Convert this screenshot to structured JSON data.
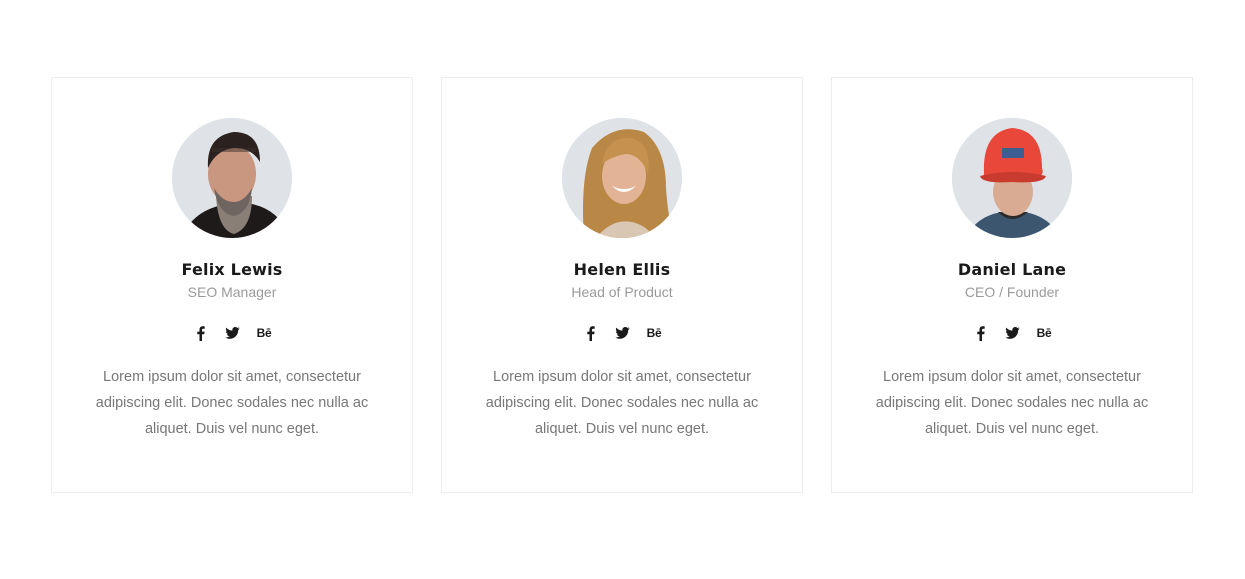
{
  "team": {
    "members": [
      {
        "name": "Felix Lewis",
        "role": "SEO Manager",
        "bio": "Lorem ipsum dolor sit amet, consectetur adipiscing elit. Donec sodales nec nulla ac aliquet. Duis vel nunc eget.",
        "social": [
          "facebook-icon",
          "twitter-icon",
          "behance-icon"
        ]
      },
      {
        "name": "Helen Ellis",
        "role": "Head of Product",
        "bio": "Lorem ipsum dolor sit amet, consectetur adipiscing elit. Donec sodales nec nulla ac aliquet. Duis vel nunc eget.",
        "social": [
          "facebook-icon",
          "twitter-icon",
          "behance-icon"
        ]
      },
      {
        "name": "Daniel Lane",
        "role": "CEO / Founder",
        "bio": "Lorem ipsum dolor sit amet, consectetur adipiscing elit. Donec sodales nec nulla ac aliquet. Duis vel nunc eget.",
        "social": [
          "facebook-icon",
          "twitter-icon",
          "behance-icon"
        ]
      }
    ],
    "social_labels": {
      "behance": "Bē"
    }
  },
  "colors": {
    "background": "#ffffff",
    "card_border": "#ededed",
    "name_text": "#1a1a1a",
    "role_text": "#9a9a9a",
    "body_text": "#777777",
    "avatar_bg": "#dde2e7",
    "cap_red": "#e8473a"
  }
}
